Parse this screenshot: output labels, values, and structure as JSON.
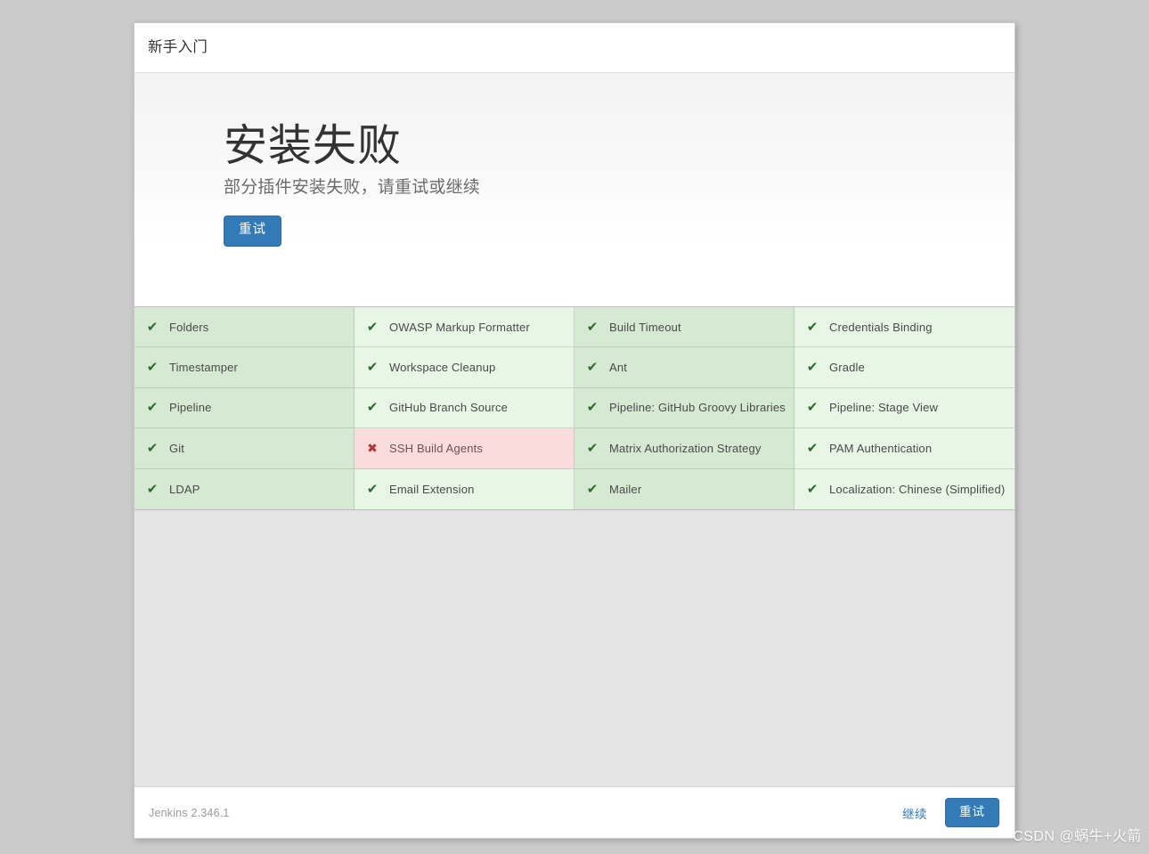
{
  "window": {
    "page_background": "#cbcbcb",
    "dialog_background": "#ffffff"
  },
  "header": {
    "title": "新手入门"
  },
  "hero": {
    "title": "安装失败",
    "subtitle": "部分插件安装失败，请重试或继续",
    "retry_label": "重试",
    "accent_color": "#337ab7"
  },
  "plugin_grid": {
    "columns": 4,
    "success_icon": "check-icon",
    "failure_icon": "cross-icon",
    "success_glyph": "✔",
    "failure_glyph": "✖",
    "success_color": "#2d6b2d",
    "failure_color": "#b03434",
    "col_odd_bg": "#d6e9d2",
    "col_even_bg": "#e7f6e5",
    "fail_bg": "#fadcdc",
    "rows": [
      [
        {
          "name": "Folders",
          "status": "ok"
        },
        {
          "name": "OWASP Markup Formatter",
          "status": "ok"
        },
        {
          "name": "Build Timeout",
          "status": "ok"
        },
        {
          "name": "Credentials Binding",
          "status": "ok"
        }
      ],
      [
        {
          "name": "Timestamper",
          "status": "ok"
        },
        {
          "name": "Workspace Cleanup",
          "status": "ok"
        },
        {
          "name": "Ant",
          "status": "ok"
        },
        {
          "name": "Gradle",
          "status": "ok"
        }
      ],
      [
        {
          "name": "Pipeline",
          "status": "ok"
        },
        {
          "name": "GitHub Branch Source",
          "status": "ok"
        },
        {
          "name": "Pipeline: GitHub Groovy Libraries",
          "status": "ok"
        },
        {
          "name": "Pipeline: Stage View",
          "status": "ok"
        }
      ],
      [
        {
          "name": "Git",
          "status": "ok"
        },
        {
          "name": "SSH Build Agents",
          "status": "fail"
        },
        {
          "name": "Matrix Authorization Strategy",
          "status": "ok"
        },
        {
          "name": "PAM Authentication",
          "status": "ok"
        }
      ],
      [
        {
          "name": "LDAP",
          "status": "ok"
        },
        {
          "name": "Email Extension",
          "status": "ok"
        },
        {
          "name": "Mailer",
          "status": "ok"
        },
        {
          "name": "Localization: Chinese (Simplified)",
          "status": "ok"
        }
      ]
    ]
  },
  "footer": {
    "version": "Jenkins 2.346.1",
    "continue_label": "继续",
    "retry_label": "重试"
  },
  "watermark": {
    "text": "CSDN @蜗牛+火箭"
  }
}
